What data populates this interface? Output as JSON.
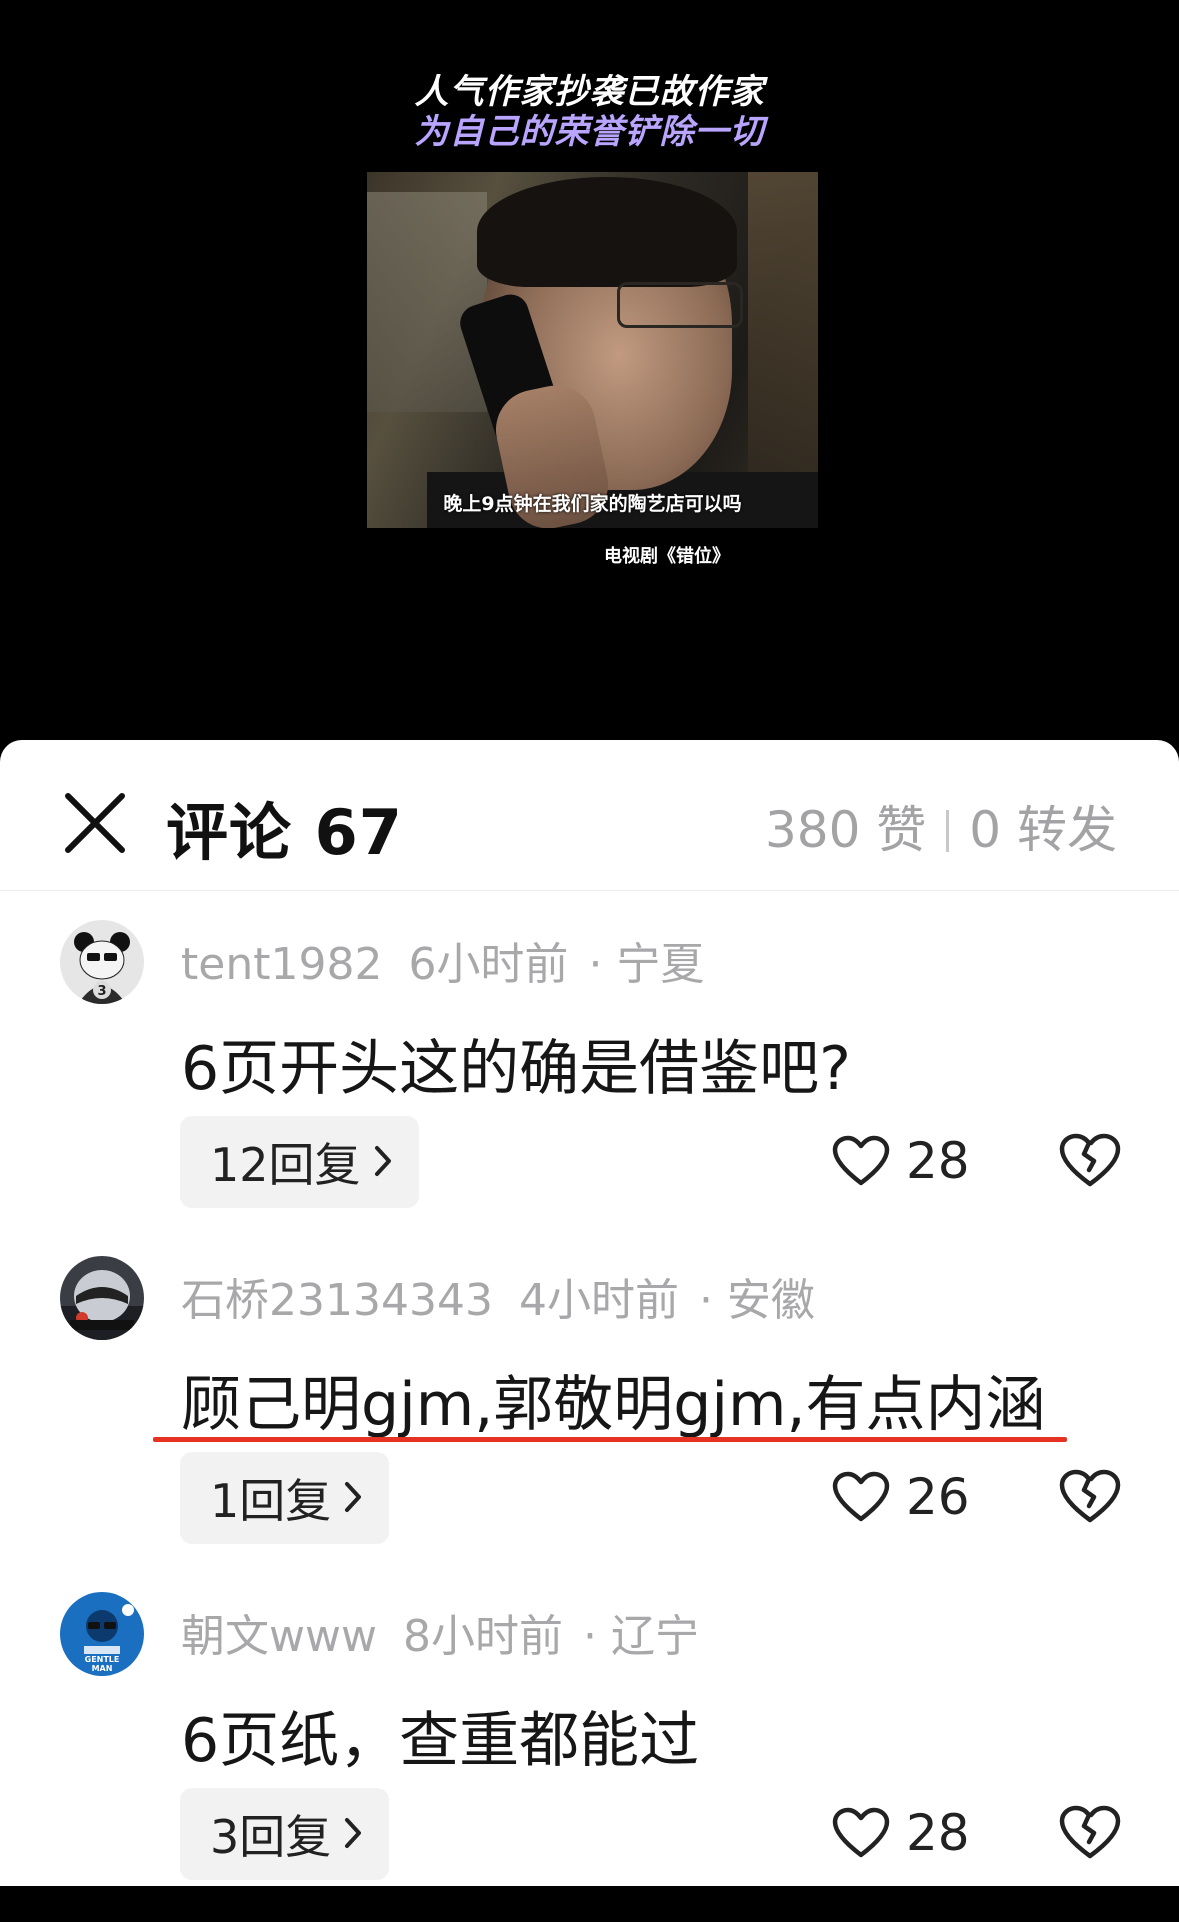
{
  "video": {
    "caption_line1": "人气作家抄袭已故作家",
    "caption_line2": "为自己的荣誉铲除一切",
    "subtitle": "晚上9点钟在我们家的陶艺店可以吗",
    "source": "电视剧《错位》"
  },
  "header": {
    "close_icon": "close-icon",
    "title": "评论 67",
    "likes": "380 赞",
    "shares": "0 转发"
  },
  "comments": [
    {
      "username": "tent1982",
      "time": "6小时前",
      "location": "· 宁夏",
      "text": "6页开头这的确是借鉴吧?",
      "replies": "12回复",
      "likes": "28",
      "avatar_icon": "panda-avatar-icon"
    },
    {
      "username": "石桥23134343",
      "time": "4小时前",
      "location": "· 安徽",
      "text": "顾己明gjm,郭敬明gjm,有点内涵",
      "replies": "1回复",
      "likes": "26",
      "avatar_icon": "helmet-avatar-icon",
      "highlight_color": "#e53223"
    },
    {
      "username": "朝文www",
      "time": "8小时前",
      "location": "· 辽宁",
      "text": "6页纸，查重都能过",
      "replies": "3回复",
      "likes": "28",
      "avatar_icon": "gentleman-avatar-icon"
    }
  ]
}
